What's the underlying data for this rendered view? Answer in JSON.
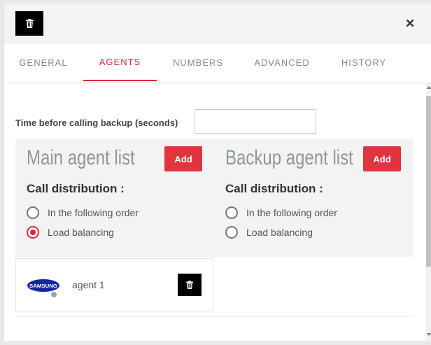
{
  "header": {
    "delete_icon": "trash-icon",
    "close_icon": "close-icon"
  },
  "tabs": [
    {
      "label": "GENERAL",
      "active": false
    },
    {
      "label": "AGENTS",
      "active": true
    },
    {
      "label": "NUMBERS",
      "active": false
    },
    {
      "label": "ADVANCED",
      "active": false
    },
    {
      "label": "HISTORY",
      "active": false
    }
  ],
  "time_backup": {
    "label": "Time before calling backup (seconds)",
    "value": ""
  },
  "main_list": {
    "title": "Main agent list",
    "add_label": "Add",
    "distribution_label": "Call distribution :",
    "options": [
      {
        "label": "In the following order",
        "checked": false
      },
      {
        "label": "Load balancing",
        "checked": true
      }
    ]
  },
  "backup_list": {
    "title": "Backup agent list",
    "add_label": "Add",
    "distribution_label": "Call distribution :",
    "options": [
      {
        "label": "In the following order",
        "checked": false
      },
      {
        "label": "Load balancing",
        "checked": false
      }
    ]
  },
  "agents": [
    {
      "name": "agent 1",
      "logo_text": "SAMSUNG",
      "status": "offline",
      "delete_icon": "trash-icon"
    }
  ],
  "colors": {
    "accent": "#d62a3a",
    "add_button": "#e0343f",
    "title_gray": "#8e979f",
    "samsung_blue": "#1428a0"
  }
}
